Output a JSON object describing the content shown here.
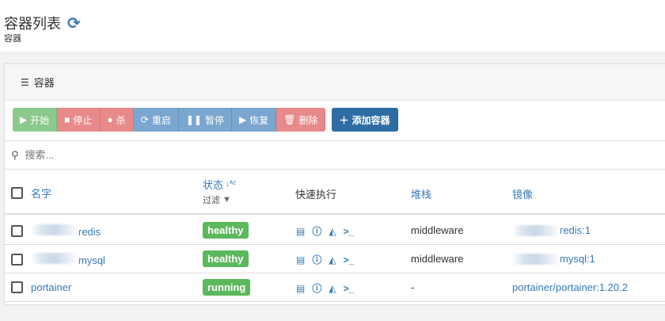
{
  "header": {
    "title": "容器列表",
    "subtitle": "容器"
  },
  "widget": {
    "title": "容器"
  },
  "toolbar": {
    "start": "开始",
    "stop": "停止",
    "kill": "杀",
    "restart": "重启",
    "pause": "暂停",
    "resume": "恢复",
    "remove": "删除",
    "add": "添加容器"
  },
  "search": {
    "placeholder": "搜索..."
  },
  "table": {
    "columns": {
      "name": "名字",
      "state": "状态",
      "filter": "过滤",
      "quick": "快速执行",
      "stack": "堆栈",
      "image": "镜像"
    },
    "rows": [
      {
        "name": "redis",
        "state": "healthy",
        "stack": "middleware",
        "image": "redis:1"
      },
      {
        "name": "mysql",
        "state": "healthy",
        "stack": "middleware",
        "image": "mysql:1"
      },
      {
        "name": "portainer",
        "state": "running",
        "stack": "-",
        "image": "portainer/portainer:1.20.2"
      }
    ]
  }
}
